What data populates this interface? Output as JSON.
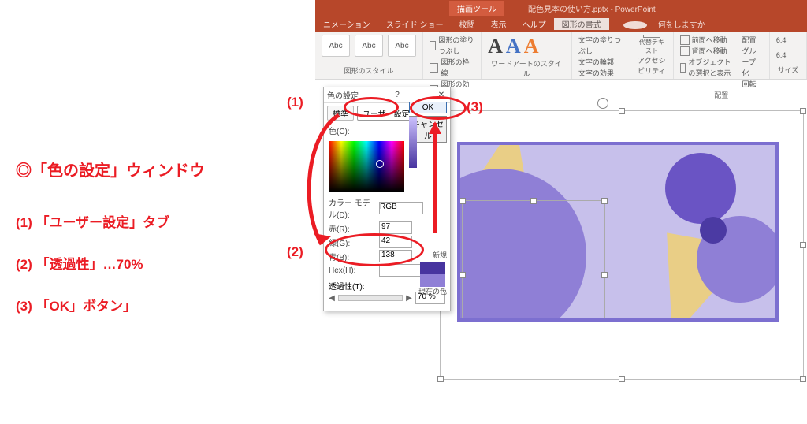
{
  "app": {
    "toolTab": "描画ツール",
    "filename": "配色見本の使い方.pptx - PowerPoint"
  },
  "menu": {
    "items": [
      "ニメーション",
      "スライド ショー",
      "校閲",
      "表示",
      "ヘルプ"
    ],
    "active": "図形の書式",
    "tellme": "何をしますか"
  },
  "ribbon": {
    "abc": "Abc",
    "g1": "図形のスタイル",
    "fill": "図形の塗りつぶし",
    "outline": "図形の枠線",
    "effects": "図形の効果",
    "g2": "ワードアートのスタイル",
    "tfill": "文字の塗りつぶし",
    "toutline": "文字の輪郭",
    "teffects": "文字の効果",
    "alt": "代替テキスト",
    "g3": "アクセシビリティ",
    "front": "前面へ移動",
    "back": "背面へ移動",
    "pane": "オブジェクトの選択と表示",
    "align": "配置",
    "group": "グループ化",
    "rotate": "回転",
    "g4": "配置",
    "sizeLabel": "サイズ",
    "sizeVal": "6.4"
  },
  "dlg": {
    "title": "色の設定",
    "tab_std": "標準",
    "tab_custom": "ユーザー設定",
    "ok": "OK",
    "cancel": "キャンセル",
    "color": "色(C):",
    "model": "カラー モデル(D):",
    "modelVal": "RGB",
    "r": "赤(R):",
    "rVal": "97",
    "g": "緑(G):",
    "gVal": "42",
    "b": "青(B):",
    "bVal": "138",
    "hex": "Hex(H):",
    "newLbl": "新規",
    "curLbl": "現在の色",
    "trans": "透過性(T):",
    "transVal": "70 %"
  },
  "ann": {
    "header": "◎「色の設定」ウィンドウ",
    "l1": "(1) 「ユーザー設定」タブ",
    "l2": "(2) 「透過性」…70%",
    "l3": "(3)  「OK」ボタン」",
    "m1": "(1)",
    "m2": "(2)",
    "m3": "(3)"
  }
}
